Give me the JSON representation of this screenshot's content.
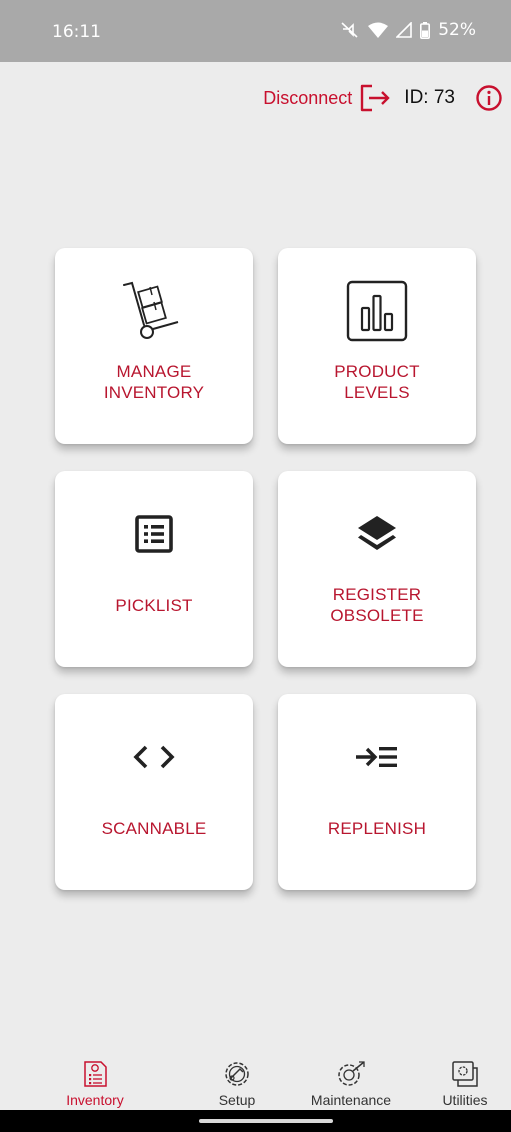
{
  "status_bar": {
    "time": "16:11",
    "battery": "52%",
    "icons": [
      "mute-icon",
      "wifi-icon",
      "signal-icon",
      "battery-icon"
    ]
  },
  "header": {
    "disconnect_label": "Disconnect",
    "id_text": "ID: 73",
    "icons": [
      "logout-icon",
      "info-icon"
    ]
  },
  "tiles": [
    {
      "label": "MANAGE\nINVENTORY",
      "icon": "hand-truck-icon"
    },
    {
      "label": "PRODUCT\nLEVELS",
      "icon": "bar-chart-icon"
    },
    {
      "label": "PICKLIST",
      "icon": "list-icon"
    },
    {
      "label": "REGISTER\nOBSOLETE",
      "icon": "layers-icon"
    },
    {
      "label": "SCANNABLE",
      "icon": "code-brackets-icon"
    },
    {
      "label": "REPLENISH",
      "icon": "arrow-list-icon"
    }
  ],
  "bottom_nav": {
    "items": [
      {
        "label": "Inventory",
        "icon": "inventory-icon",
        "active": true
      },
      {
        "label": "Setup",
        "icon": "setup-icon",
        "active": false
      },
      {
        "label": "Maintenance",
        "icon": "maintenance-icon",
        "active": false
      },
      {
        "label": "Utilities",
        "icon": "utilities-icon",
        "active": false
      }
    ]
  },
  "colors": {
    "accent": "#c8102e",
    "background": "#ececec",
    "status_bar": "#a9a9a9",
    "tile": "#ffffff"
  }
}
